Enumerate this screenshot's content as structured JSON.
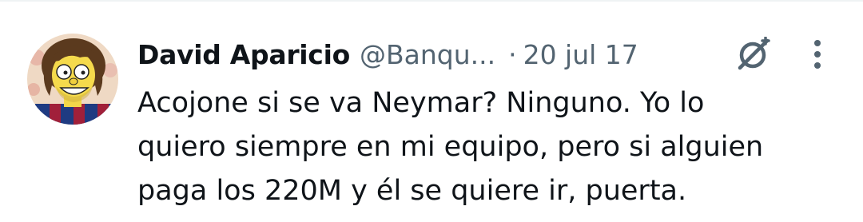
{
  "tweet": {
    "author_name": "David Aparicio",
    "handle": "@Banqu...",
    "separator": "·",
    "date": "20 jul 17",
    "text_lines": [
      "Acojone si se va Neymar? Ninguno. Yo lo",
      "quiero siempre en mi equipo, pero si alguien",
      "paga los 220M y él se quiere ir, puerta."
    ]
  },
  "icons": {
    "avatar": "avatar-image",
    "grok": "grok-icon",
    "more": "more-options-icon"
  },
  "colors": {
    "primary_text": "#0f1419",
    "secondary_text": "#536471",
    "background": "#ffffff",
    "divider": "#eff3f4"
  }
}
